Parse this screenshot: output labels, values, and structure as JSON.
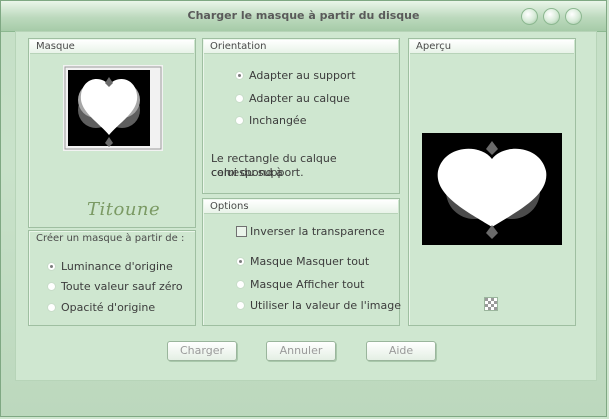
{
  "window": {
    "title": "Charger le masque à partir du disque"
  },
  "masque": {
    "header": "Masque",
    "signature": "Titoune"
  },
  "create": {
    "header": "Créer un masque à partir de :",
    "options": [
      {
        "label": "Luminance d'origine",
        "selected": true
      },
      {
        "label": "Toute valeur sauf zéro",
        "selected": false
      },
      {
        "label": "Opacité d'origine",
        "selected": false
      }
    ]
  },
  "orientation": {
    "header": "Orientation",
    "options": [
      {
        "label": "Adapter au support",
        "selected": true
      },
      {
        "label": "Adapter au calque",
        "selected": false
      },
      {
        "label": "Inchangée",
        "selected": false
      }
    ],
    "description_line1": "Le rectangle du calque correspond à",
    "description_line2": "celui du support."
  },
  "options": {
    "header": "Options",
    "invert_label": "Inverser la transparence",
    "invert_checked": false,
    "radios": [
      {
        "label": "Masque Masquer tout",
        "selected": true
      },
      {
        "label": "Masque Afficher tout",
        "selected": false
      },
      {
        "label": "Utiliser la valeur de l'image",
        "selected": false
      }
    ]
  },
  "apercu": {
    "header": "Aperçu"
  },
  "buttons": {
    "charger": "Charger",
    "annuler": "Annuler",
    "aide": "Aide"
  },
  "colors": {
    "window_bg": "#c9e2ca",
    "panel_bg": "#cfe7d0",
    "disabled_text": "#9a9a9a",
    "signature": "#7b9a64"
  }
}
